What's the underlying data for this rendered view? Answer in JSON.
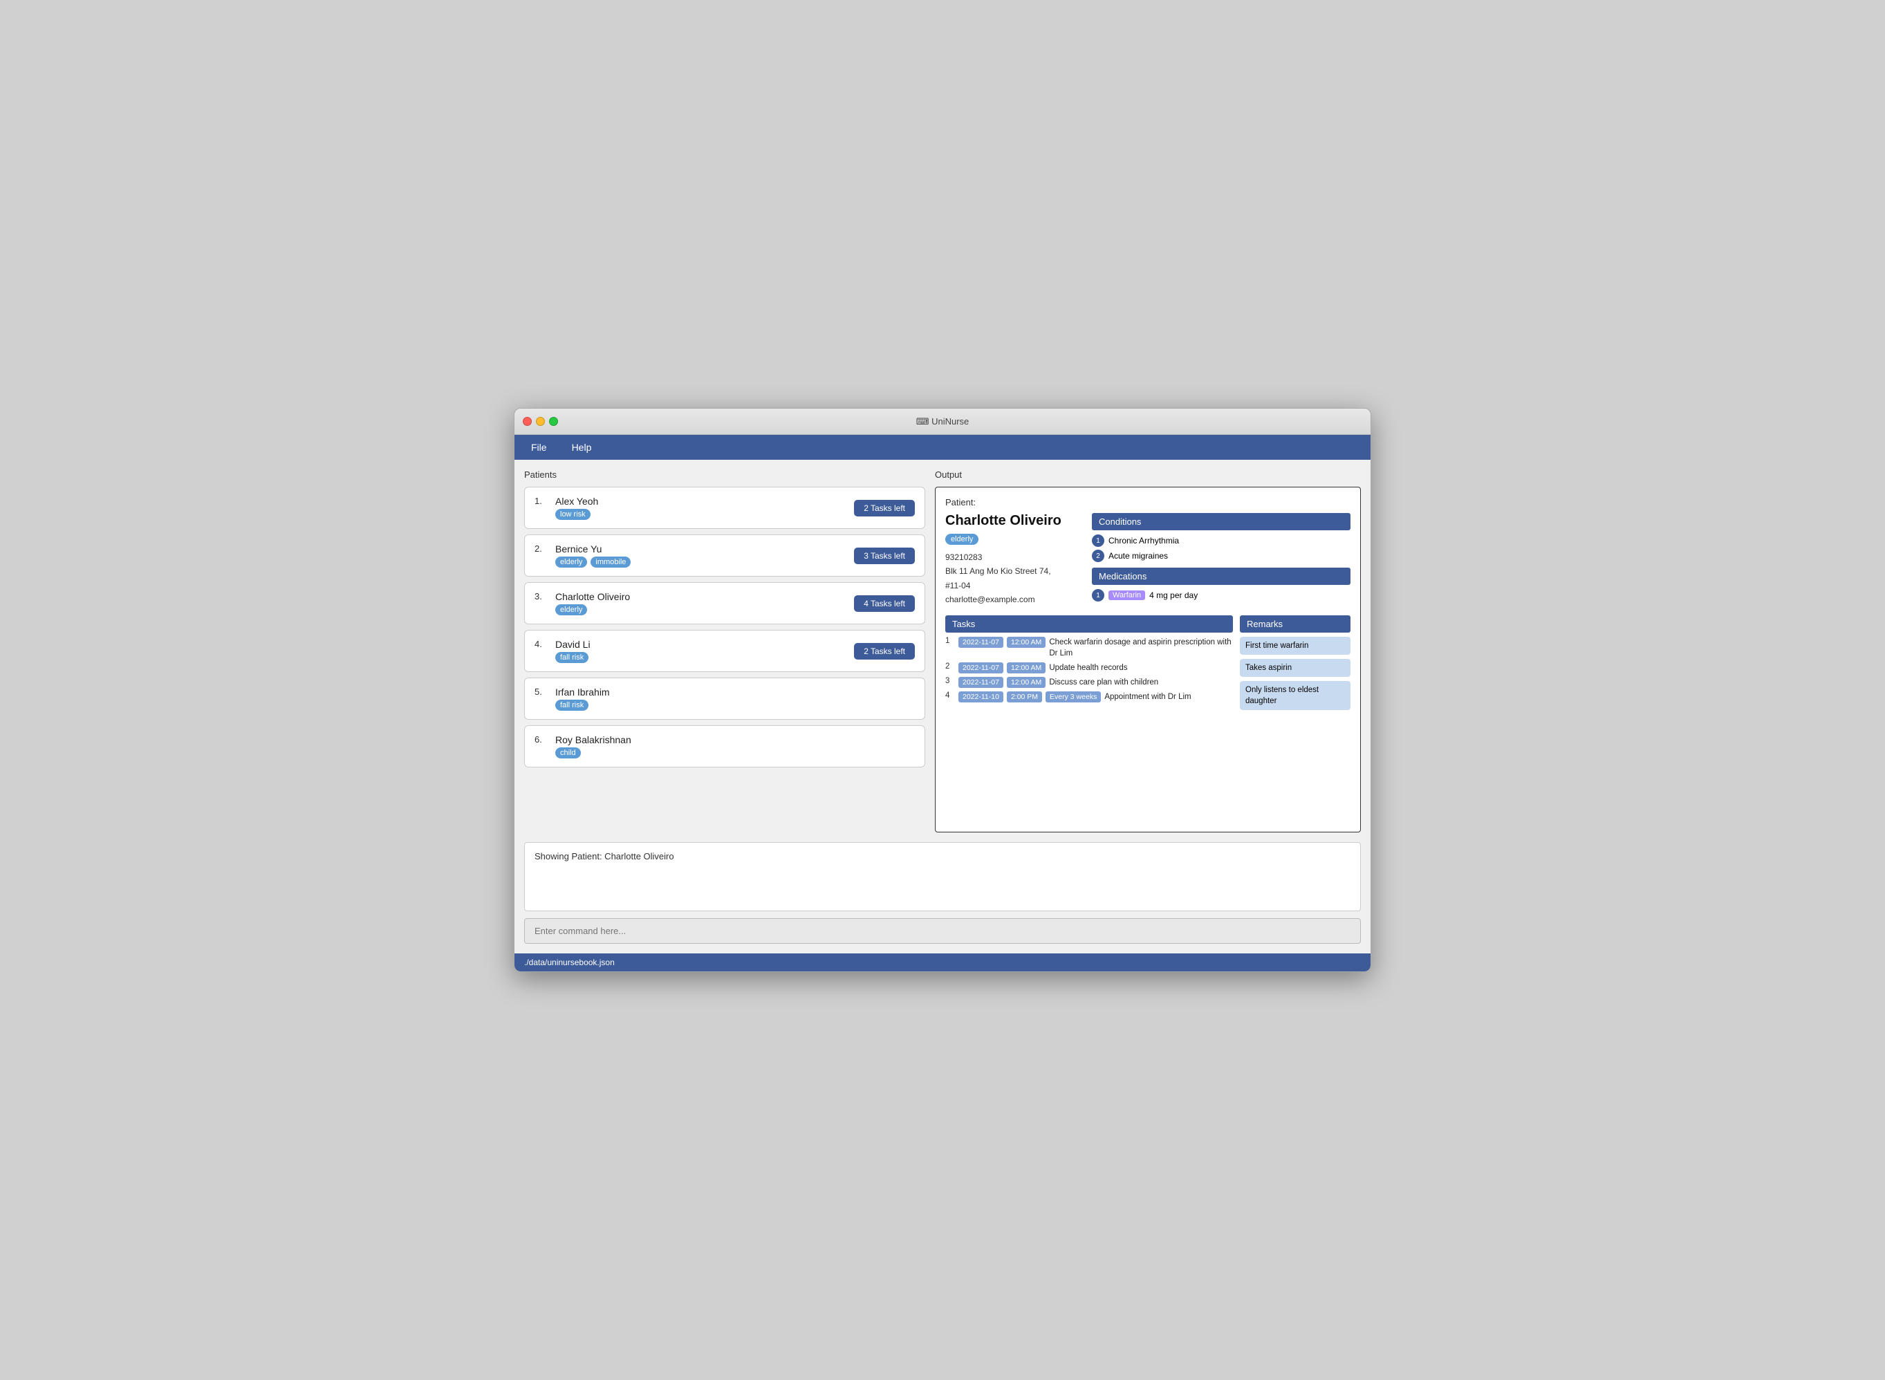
{
  "window": {
    "title": "⌨ UniNurse",
    "title_icon": "⌨"
  },
  "menu": {
    "items": [
      "File",
      "Help"
    ]
  },
  "patients_panel": {
    "header": "Patients",
    "patients": [
      {
        "num": "1.",
        "name": "Alex Yeoh",
        "tags": [
          {
            "label": "low risk",
            "class": "tag-low-risk"
          }
        ],
        "tasks": "2 Tasks left"
      },
      {
        "num": "2.",
        "name": "Bernice Yu",
        "tags": [
          {
            "label": "elderly",
            "class": "tag-elderly"
          },
          {
            "label": "immobile",
            "class": "tag-immobile"
          }
        ],
        "tasks": "3 Tasks left"
      },
      {
        "num": "3.",
        "name": "Charlotte Oliveiro",
        "tags": [
          {
            "label": "elderly",
            "class": "tag-elderly"
          }
        ],
        "tasks": "4 Tasks left"
      },
      {
        "num": "4.",
        "name": "David Li",
        "tags": [
          {
            "label": "fall risk",
            "class": "tag-fall-risk"
          }
        ],
        "tasks": "2 Tasks left"
      },
      {
        "num": "5.",
        "name": "Irfan Ibrahim",
        "tags": [
          {
            "label": "fall risk",
            "class": "tag-fall-risk"
          }
        ],
        "tasks": null
      },
      {
        "num": "6.",
        "name": "Roy Balakrishnan",
        "tags": [
          {
            "label": "child",
            "class": "tag-child"
          }
        ],
        "tasks": null
      }
    ]
  },
  "output_panel": {
    "header": "Output",
    "patient_label": "Patient:",
    "selected_patient": {
      "name": "Charlotte Oliveiro",
      "tag": "elderly",
      "id": "93210283",
      "address": "Blk 11 Ang Mo Kio Street 74,\n#11-04",
      "email": "charlotte@example.com",
      "conditions_header": "Conditions",
      "conditions": [
        {
          "num": "1",
          "text": "Chronic Arrhythmia"
        },
        {
          "num": "2",
          "text": "Acute migraines"
        }
      ],
      "medications_header": "Medications",
      "medications": [
        {
          "num": "1",
          "badge": "Warfarin",
          "text": "4 mg per day"
        }
      ],
      "tasks_header": "Tasks",
      "tasks": [
        {
          "num": "1",
          "date": "2022-11-07",
          "time": "12:00 AM",
          "recur": null,
          "desc": "Check warfarin dosage and aspirin prescription with Dr Lim"
        },
        {
          "num": "2",
          "date": "2022-11-07",
          "time": "12:00 AM",
          "recur": null,
          "desc": "Update health records"
        },
        {
          "num": "3",
          "date": "2022-11-07",
          "time": "12:00 AM",
          "recur": null,
          "desc": "Discuss care plan with children"
        },
        {
          "num": "4",
          "date": "2022-11-10",
          "time": "2:00 PM",
          "recur": "Every 3 weeks",
          "desc": "Appointment with Dr Lim"
        }
      ],
      "remarks_header": "Remarks",
      "remarks": [
        "First time warfarin",
        "Takes aspirin",
        "Only listens to eldest daughter"
      ]
    }
  },
  "status_bar": {
    "text": "Showing Patient: Charlotte Oliveiro"
  },
  "command_input": {
    "placeholder": "Enter command here..."
  },
  "filepath_bar": {
    "text": "./data/uninursebook.json"
  }
}
